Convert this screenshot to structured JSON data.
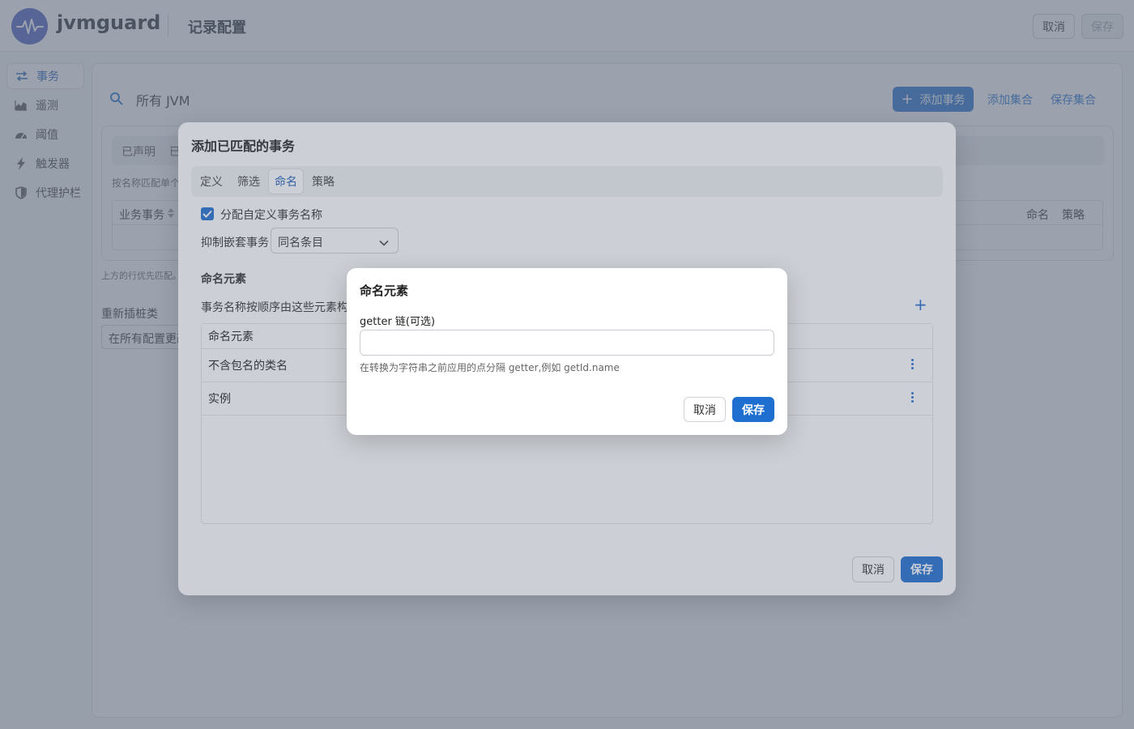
{
  "header": {
    "brand": "jvmguard",
    "title": "记录配置",
    "cancel_label": "取消",
    "save_label": "保存"
  },
  "sidebar": {
    "items": [
      {
        "label": "事务",
        "icon": "transactions-icon",
        "active": true
      },
      {
        "label": "遥测",
        "icon": "chart-icon",
        "active": false
      },
      {
        "label": "阈值",
        "icon": "gauge-icon",
        "active": false
      },
      {
        "label": "触发器",
        "icon": "lightning-icon",
        "active": false
      },
      {
        "label": "代理护栏",
        "icon": "shield-icon",
        "active": false
      }
    ]
  },
  "main": {
    "scope_label": "所有 JVM",
    "add_transaction_label": "添加事务",
    "add_set_label": "添加集合",
    "save_set_label": "保存集合",
    "seg_tabs": [
      "已声明",
      "已"
    ],
    "hint": "按名称匹配单个方",
    "table_headers": {
      "business_tx": "业务事务",
      "naming": "命名",
      "policy": "策略"
    },
    "priority_note": "上方的行优先匹配。",
    "reinstrument_label": "重新插桩类",
    "reinstrument_value": "在所有配置更改"
  },
  "dialog": {
    "title": "添加已匹配的事务",
    "tabs": [
      "定义",
      "筛选",
      "命名",
      "策略"
    ],
    "active_tab": "命名",
    "checkbox_label": "分配自定义事务名称",
    "checkbox_checked": true,
    "suppress_label": "抑制嵌套事务",
    "suppress_value": "同名条目",
    "naming_section_title": "命名元素",
    "naming_desc": "事务名称按顺序由这些元素构建",
    "naming_table_header": "命名元素",
    "naming_rows": [
      "不含包名的类名",
      "实例"
    ],
    "cancel_label": "取消",
    "save_label": "保存"
  },
  "subdialog": {
    "title": "命名元素",
    "field_label": "getter 链(可选)",
    "field_value": "",
    "field_help": "在转换为字符串之前应用的点分隔 getter,例如 getId.name",
    "cancel_label": "取消",
    "save_label": "保存"
  },
  "colors": {
    "accent": "#1f6fd1",
    "brand": "#4a5fc4"
  }
}
